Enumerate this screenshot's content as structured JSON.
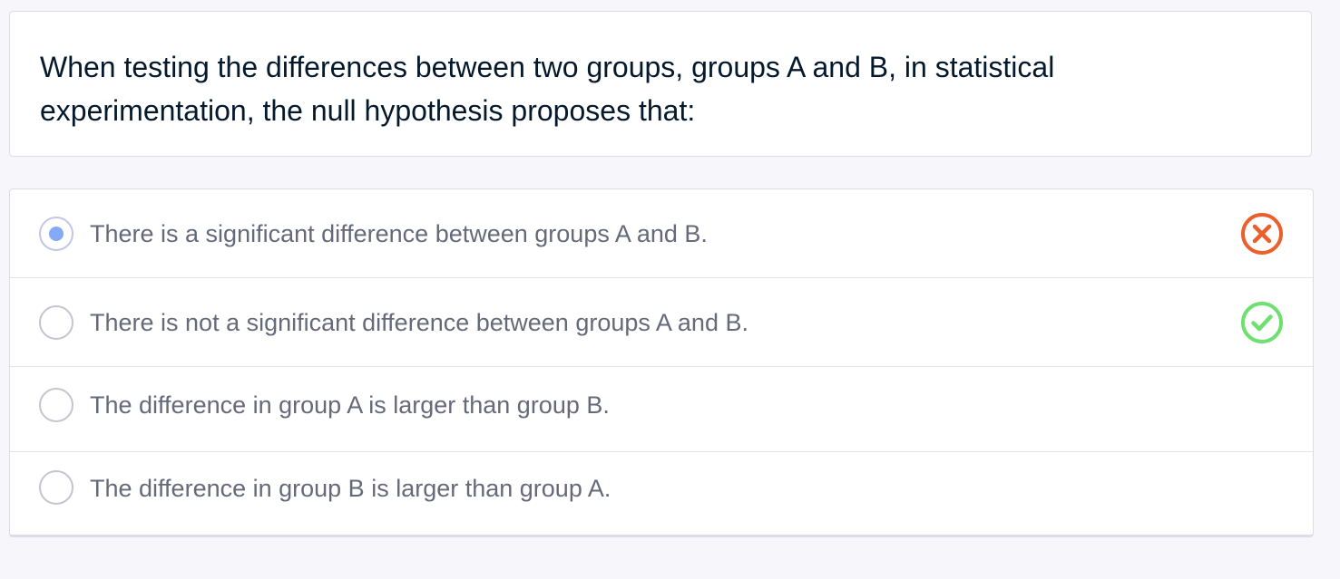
{
  "question": {
    "text": "When testing the differences between two groups, groups A and B, in statistical experimentation, the null hypothesis proposes that:"
  },
  "options": [
    {
      "label": "There is a significant difference between groups A and B.",
      "selected": true,
      "status": "incorrect",
      "status_icon": "x-circle-icon"
    },
    {
      "label": "There is not a significant difference between groups A and B.",
      "selected": false,
      "status": "correct",
      "status_icon": "check-circle-icon"
    },
    {
      "label": "The difference in group A is larger than group B.",
      "selected": false,
      "status": "none"
    },
    {
      "label": "The difference in group B is larger than group A.",
      "selected": false,
      "status": "none"
    }
  ],
  "colors": {
    "incorrect": "#ea5f2c",
    "correct": "#6ee070",
    "radio_selected_dot": "#85aaf5",
    "question_text": "#05192d",
    "option_text": "#65697a"
  }
}
